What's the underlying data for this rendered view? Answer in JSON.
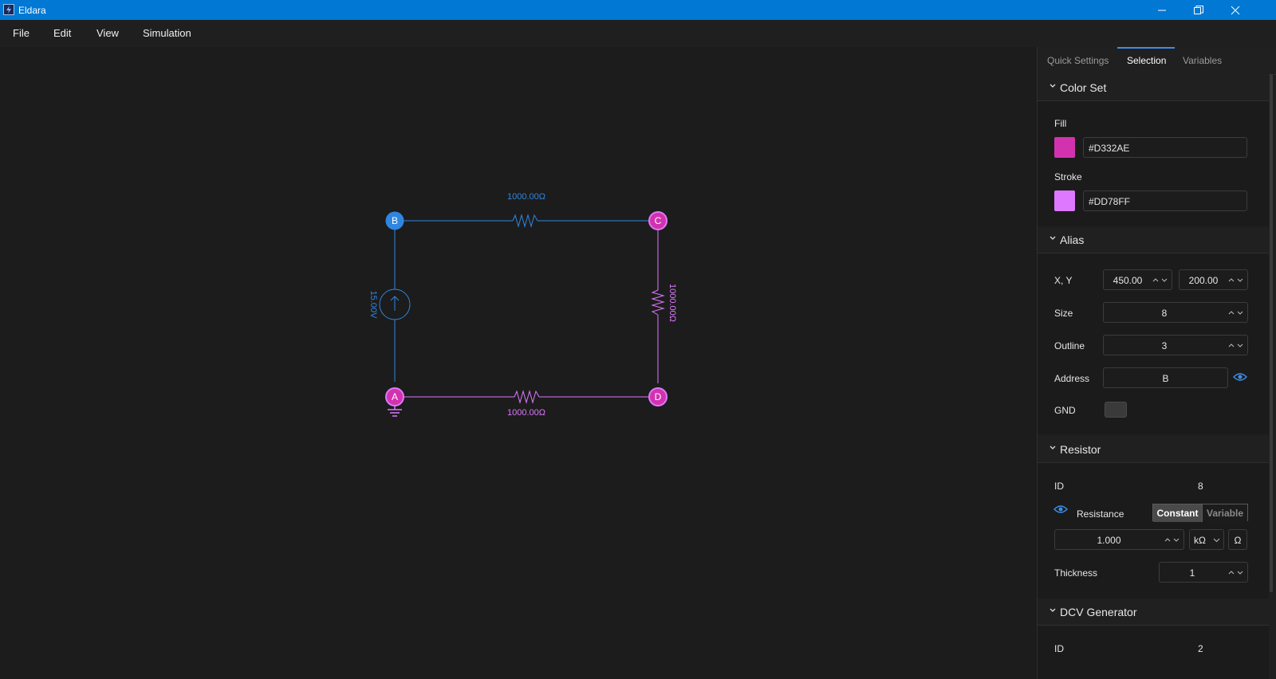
{
  "window": {
    "title": "Eldara"
  },
  "menu": [
    "File",
    "Edit",
    "View",
    "Simulation"
  ],
  "colors": {
    "accent": "#0078d4",
    "blue_node": "#2f86e0",
    "pink_node": "#d332ae",
    "pink_stroke": "#dd78ff",
    "link": "#3b8eea"
  },
  "circuit": {
    "nodes": [
      {
        "label": "B",
        "color": "#2f86e0"
      },
      {
        "label": "C",
        "color": "#d332ae"
      },
      {
        "label": "A",
        "color": "#d332ae"
      },
      {
        "label": "D",
        "color": "#d332ae"
      }
    ],
    "top_resistor_label": "1000.00Ω",
    "right_resistor_label": "1000.00Ω",
    "bottom_resistor_label": "1000.00Ω",
    "source_label": "15.00V"
  },
  "panel": {
    "tabs": [
      {
        "label": "Quick Settings",
        "active": false
      },
      {
        "label": "Selection",
        "active": true
      },
      {
        "label": "Variables",
        "active": false
      }
    ],
    "color_set": {
      "title": "Color Set",
      "fill_label": "Fill",
      "fill_value": "#D332AE",
      "stroke_label": "Stroke",
      "stroke_value": "#DD78FF"
    },
    "alias": {
      "title": "Alias",
      "xy_label": "X, Y",
      "x_value": "450.00",
      "y_value": "200.00",
      "size_label": "Size",
      "size_value": "8",
      "outline_label": "Outline",
      "outline_value": "3",
      "address_label": "Address",
      "address_value": "B",
      "gnd_label": "GND"
    },
    "resistor": {
      "title": "Resistor",
      "id_label": "ID",
      "id_value": "8",
      "resistance_label": "Resistance",
      "constant_label": "Constant",
      "variable_label": "Variable",
      "resistance_value": "1.000",
      "unit_value": "kΩ",
      "ohm_button": "Ω",
      "thickness_label": "Thickness",
      "thickness_value": "1"
    },
    "dcv": {
      "title": "DCV Generator",
      "id_label": "ID",
      "id_value": "2"
    }
  }
}
